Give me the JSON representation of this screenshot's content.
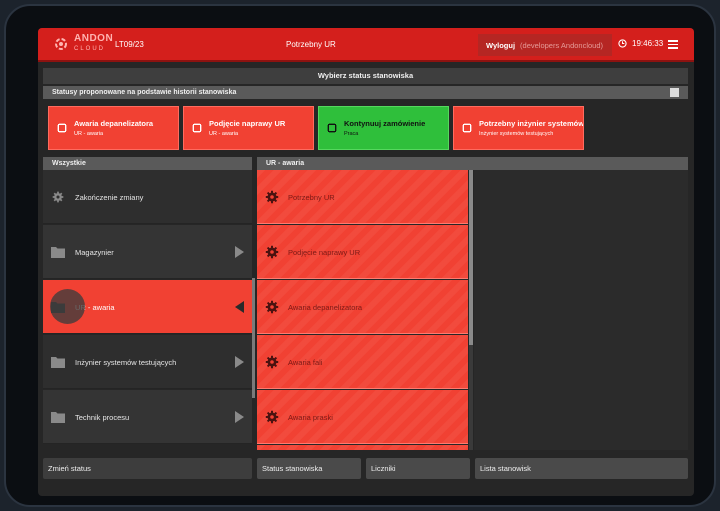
{
  "header": {
    "logo_line1": "ANDON",
    "logo_line2": "CLOUD",
    "station": "LT09/23",
    "title": "Potrzebny UR",
    "logout_label": "Wyloguj",
    "user": "(developers Andoncloud)",
    "time": "19:46:33"
  },
  "status_title": "Wybierz status stanowiska",
  "suggested": {
    "heading": "Statusy proponowane na podstawie historii stanowiska",
    "cards": [
      {
        "title": "Awaria depanelizatora",
        "subtitle": "UR - awaria",
        "color": "red"
      },
      {
        "title": "Podjęcie naprawy UR",
        "subtitle": "UR - awaria",
        "color": "red"
      },
      {
        "title": "Kontynuuj zamówienie",
        "subtitle": "Praca",
        "color": "green"
      },
      {
        "title": "Potrzebny inżynier systemów testujących",
        "subtitle": "Inżynier systemów testujących",
        "color": "red"
      }
    ]
  },
  "left_column": {
    "heading": "Wszystkie",
    "items": [
      {
        "label": "Zakończenie zmiany",
        "icon": "gear-icon"
      },
      {
        "label": "Magazynier",
        "icon": "folder-icon"
      },
      {
        "label": "UR - awaria",
        "icon": "folder-icon"
      },
      {
        "label": "Inżynier systemów testujących",
        "icon": "folder-icon"
      },
      {
        "label": "Technik procesu",
        "icon": "folder-icon"
      }
    ]
  },
  "middle_column": {
    "heading": "UR - awaria",
    "items": [
      {
        "label": "Potrzebny UR"
      },
      {
        "label": "Podjęcie naprawy UR"
      },
      {
        "label": "Awaria depanelizatora"
      },
      {
        "label": "Awaria fali"
      },
      {
        "label": "Awaria praski"
      }
    ]
  },
  "bottom_buttons": {
    "change_status": "Zmień status",
    "station_status": "Status stanowiska",
    "counters": "Liczniki",
    "stations_list": "Lista stanowisk"
  },
  "colors": {
    "brand_red": "#d41f1c",
    "status_red": "#f14133",
    "status_green": "#2fbf3b"
  }
}
